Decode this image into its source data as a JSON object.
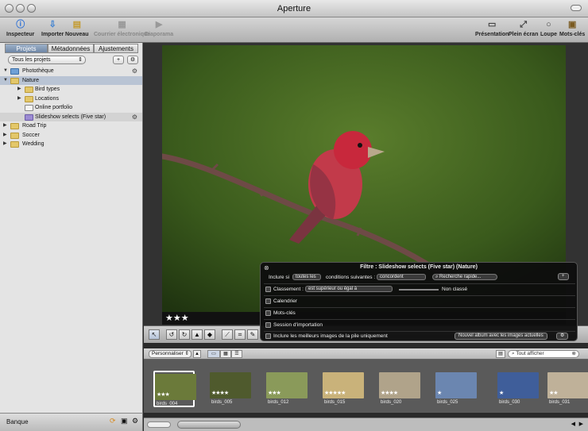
{
  "window": {
    "title": "Aperture"
  },
  "toolbar": {
    "inspecteur": "Inspecteur",
    "importer": "Importer",
    "nouveau": "Nouveau",
    "courrier": "Courrier électronique",
    "diaporama": "Diaporama",
    "presentation": "Présentation",
    "plein_ecran": "Plein écran",
    "loupe": "Loupe",
    "mots_cles": "Mots-clés"
  },
  "left": {
    "tabs": [
      "Projets",
      "Métadonnées",
      "Ajustements"
    ],
    "selected_tab": "Projets",
    "project_filter": "Tous les projets",
    "tree": [
      {
        "label": "Photothèque",
        "icon": "library-icon"
      },
      {
        "label": "Nature",
        "icon": "folder-icon"
      },
      {
        "label": "Bird types",
        "icon": "folder-icon"
      },
      {
        "label": "Locations",
        "icon": "folder-icon"
      },
      {
        "label": "Online portfolio",
        "icon": "album-icon"
      },
      {
        "label": "Slideshow selects (Five star)",
        "icon": "smart-album-icon"
      },
      {
        "label": "Road Trip",
        "icon": "folder-icon"
      },
      {
        "label": "Soccer",
        "icon": "folder-icon"
      },
      {
        "label": "Wedding",
        "icon": "folder-icon"
      }
    ],
    "bottom_label": "Banque"
  },
  "viewer": {
    "rating": "★★★"
  },
  "browser": {
    "sort_label": "Personnaliser",
    "search_placeholder": "Tout afficher"
  },
  "filmstrip": [
    {
      "name": "birds_004",
      "stars": "★★★",
      "color": "#6b7a3a"
    },
    {
      "name": "birds_005",
      "stars": "★★★★",
      "color": "#4f5a2d"
    },
    {
      "name": "birds_012",
      "stars": "★★★",
      "color": "#8a9a5a"
    },
    {
      "name": "birds_015",
      "stars": "★★★★★",
      "color": "#c9b27a"
    },
    {
      "name": "birds_020",
      "stars": "★★★★",
      "color": "#b0a38a"
    },
    {
      "name": "birds_025",
      "stars": "★",
      "color": "#6b86b0"
    },
    {
      "name": "birds_030",
      "stars": "★",
      "color": "#3f5e9a"
    },
    {
      "name": "birds_031",
      "stars": "★★",
      "color": "#bfb199"
    }
  ],
  "filter": {
    "title": "Filtre : Slideshow selects (Five star) (Nature)",
    "include_if": "Inclure si",
    "match_all": "toutes les",
    "conditions_following": "conditions suivantes :",
    "match_mode": "concordent",
    "quick_search": "Recherche rapide...",
    "rating_label": "Classement :",
    "rating_op": "est supérieur ou égal à",
    "rating_value": "Non classé",
    "calendar": "Calendrier",
    "keywords": "Mots-clés",
    "import_session": "Session d'importation",
    "best_images": "Inclure les meilleurs images de la pile uniquement",
    "new_album": "Nouvel album avec les images actuelles"
  }
}
